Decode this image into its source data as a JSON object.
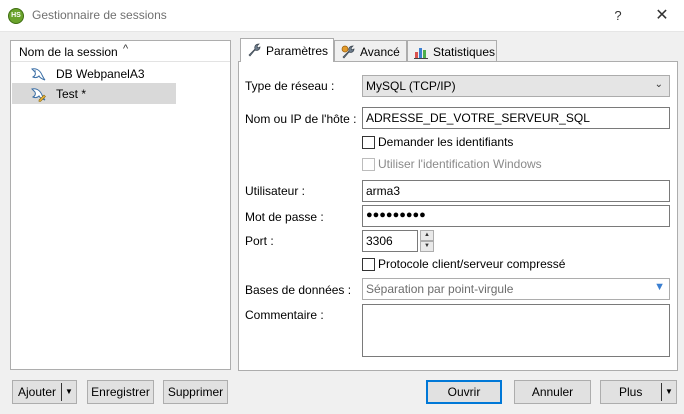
{
  "window": {
    "app_icon_text": "HS",
    "title": "Gestionnaire de sessions",
    "help_glyph": "?",
    "close_glyph": "✕"
  },
  "sessions": {
    "header": "Nom de la session",
    "sort_glyph": "^",
    "items": [
      {
        "label": "DB WebpanelA3",
        "icon": "dolphin-icon",
        "selected": false
      },
      {
        "label": "Test *",
        "icon": "dolphin-edit-icon",
        "selected": true
      }
    ]
  },
  "tabs": [
    {
      "label": "Paramètres",
      "icon": "wrench-icon",
      "active": true
    },
    {
      "label": "Avancé",
      "icon": "wrench-gear-icon",
      "active": false
    },
    {
      "label": "Statistiques",
      "icon": "bar-chart-icon",
      "active": false
    }
  ],
  "form": {
    "network_type": {
      "label": "Type de réseau :",
      "value": "MySQL (TCP/IP)"
    },
    "host": {
      "label": "Nom ou IP de l'hôte :",
      "value": "ADRESSE_DE_VOTRE_SERVEUR_SQL"
    },
    "ask_credentials": {
      "label": "Demander les identifiants",
      "checked": false
    },
    "windows_auth": {
      "label": "Utiliser l'identification Windows",
      "checked": false,
      "disabled": true
    },
    "user": {
      "label": "Utilisateur :",
      "value": "arma3"
    },
    "password": {
      "label": "Mot de passe :",
      "value": "●●●●●●●●●"
    },
    "port": {
      "label": "Port :",
      "value": "3306"
    },
    "compressed": {
      "label": "Protocole client/serveur compressé",
      "checked": false
    },
    "databases": {
      "label": "Bases de données :",
      "placeholder": "Séparation par point-virgule"
    },
    "comment": {
      "label": "Commentaire :",
      "value": ""
    }
  },
  "buttons": {
    "add": "Ajouter",
    "save": "Enregistrer",
    "delete": "Supprimer",
    "open": "Ouvrir",
    "cancel": "Annuler",
    "more": "Plus"
  },
  "colors": {
    "accent": "#0078d7",
    "selection": "#d9d9d9"
  }
}
